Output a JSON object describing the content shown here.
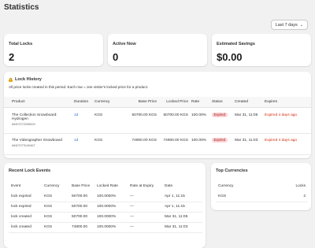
{
  "page": {
    "title": "Statistics",
    "range_label": "Last 7 days"
  },
  "stats": [
    {
      "label": "Total Locks",
      "value": "2"
    },
    {
      "label": "Active Now",
      "value": "0"
    },
    {
      "label": "Estimated Savings",
      "value": "$0.00"
    }
  ],
  "lock_history": {
    "title": "Lock History",
    "subtitle": "All price locks created in this period. Each row = one visitor's locked price for a product.",
    "columns": [
      "Product",
      "Duration",
      "Currency",
      "Base Price",
      "Locked Price",
      "Rate",
      "Status",
      "Created",
      "Expires"
    ],
    "rows": [
      {
        "product_line1": "The Collection Snowboard:",
        "product_line2": "Hydrogen",
        "sku": "#9407272206003",
        "duration": "1d",
        "currency": "KGS",
        "base": "50700.00 KGS",
        "locked": "50700.00 KGS",
        "rate": "100.00%",
        "status": "Expired",
        "created": "Mar 31, 11:06",
        "expires": "Expired 4 days ago"
      },
      {
        "product_line1": "The Videographer Snowboard",
        "product_line2": "",
        "sku": "#9407273140467",
        "duration": "1d",
        "currency": "KGS",
        "base": "74800.00 KGS",
        "locked": "74800.00 KGS",
        "rate": "100.00%",
        "status": "Expired",
        "created": "Mar 31, 11:03",
        "expires": "Expired 4 days ago"
      }
    ]
  },
  "events": {
    "title": "Recent Lock Events",
    "columns": [
      "Event",
      "Currency",
      "Base Price",
      "Locked Rate",
      "Rate at Expiry",
      "Date"
    ],
    "rows": [
      {
        "event": "lock expired",
        "currency": "KGS",
        "base": "50700.00",
        "rate": "100.0000%",
        "expiry": "—",
        "date": "Apr 1, 11:15"
      },
      {
        "event": "lock expired",
        "currency": "KGS",
        "base": "50700.00",
        "rate": "100.0000%",
        "expiry": "—",
        "date": "Apr 1, 11:15"
      },
      {
        "event": "lock created",
        "currency": "KGS",
        "base": "50700.00",
        "rate": "100.0000%",
        "expiry": "—",
        "date": "Mar 31, 11:06"
      },
      {
        "event": "lock created",
        "currency": "KGS",
        "base": "74800.00",
        "rate": "100.0000%",
        "expiry": "—",
        "date": "Mar 31, 11:03"
      }
    ]
  },
  "currencies": {
    "title": "Top Currencies",
    "columns": [
      "Currency",
      "Locks"
    ],
    "rows": [
      {
        "currency": "KGS",
        "locks": "2"
      }
    ]
  },
  "colors": {
    "expired_badge_bg": "#fed1d7",
    "expired_text": "#d72c0d",
    "link": "#2c6ecb"
  }
}
